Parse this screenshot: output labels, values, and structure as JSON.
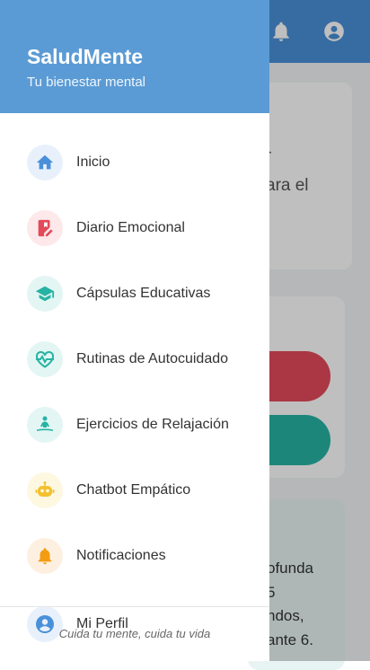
{
  "background": {
    "hero_partial": "a",
    "hero_dot": "-",
    "hero_text": "ara el",
    "quote_lines": [
      "ofunda",
      "5",
      "ndos,",
      "ante 6."
    ]
  },
  "drawer": {
    "brand": "SaludMente",
    "tagline": "Tu bienestar mental",
    "items": [
      {
        "label": "Inicio",
        "icon": "home-icon",
        "icon_color": "#4a90d9",
        "bg": "#e8f1fb"
      },
      {
        "label": "Diario Emocional",
        "icon": "journal-icon",
        "icon_color": "#e34a5a",
        "bg": "#fde8ea"
      },
      {
        "label": "Cápsulas Educativas",
        "icon": "graduation-cap-icon",
        "icon_color": "#27b3a3",
        "bg": "#e3f6f4"
      },
      {
        "label": "Rutinas de Autocuidado",
        "icon": "heart-pulse-icon",
        "icon_color": "#27b3a3",
        "bg": "#e3f6f4"
      },
      {
        "label": "Ejercicios de Relajación",
        "icon": "meditation-icon",
        "icon_color": "#27b3a3",
        "bg": "#e3f6f4"
      },
      {
        "label": "Chatbot Empático",
        "icon": "robot-icon",
        "icon_color": "#f2c12e",
        "bg": "#fef8e1"
      },
      {
        "label": "Notificaciones",
        "icon": "bell-icon",
        "icon_color": "#f39c12",
        "bg": "#fef0e0"
      },
      {
        "label": "Mi Perfil",
        "icon": "account-icon",
        "icon_color": "#4a90d9",
        "bg": "#e8f1fb"
      }
    ],
    "footer": "Cuida tu mente, cuida tu vida"
  }
}
